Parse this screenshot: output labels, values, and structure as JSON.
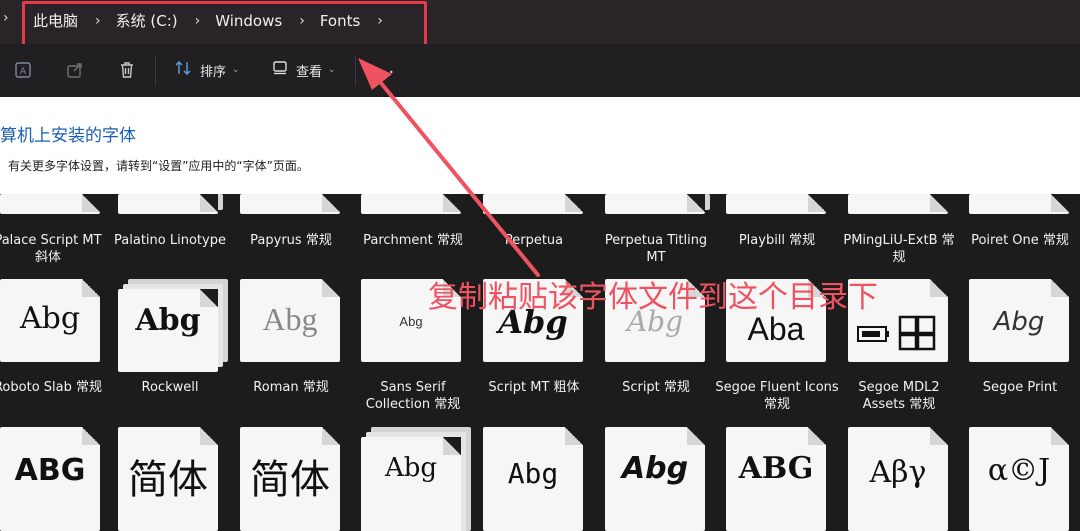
{
  "address": {
    "crumbs": [
      "此电脑",
      "系统 (C:)",
      "Windows",
      "Fonts"
    ]
  },
  "toolbar": {
    "sort_label": "排序",
    "view_label": "查看",
    "more_label": "···",
    "icons": [
      "ai-icon",
      "share-icon",
      "trash-icon",
      "sort-icon",
      "view-icon"
    ]
  },
  "header": {
    "title": "算机上安装的字体",
    "subtitle": "有关更多字体设置，请转到“设置”应用中的“字体”页面。"
  },
  "annotation": "复制粘贴该字体文件到这个目录下",
  "fonts_row1": [
    "Palace Script MT 斜体",
    "Palatino Linotype",
    "Papyrus 常规",
    "Parchment 常规",
    "Perpetua",
    "Perpetua Titling MT",
    "Playbill 常规",
    "PMingLiU-ExtB 常规",
    "Poiret One 常规"
  ],
  "fonts_row2": [
    "Roboto Slab 常规",
    "Rockwell",
    "Roman 常规",
    "Sans Serif Collection 常规",
    "Script MT 粗体",
    "Script 常规",
    "Segoe Fluent Icons 常规",
    "Segoe MDL2 Assets 常规",
    "Segoe Print"
  ],
  "samples_row2": [
    "Abg",
    "Abg",
    "Abg",
    "Abg",
    "Abg",
    "Abg",
    "Aba",
    "",
    "Abg"
  ],
  "samples_row3": [
    "ABG",
    "简体",
    "简体",
    "Abg",
    "Abg",
    "Abg",
    "ABG",
    "Aβγ",
    "α©J"
  ],
  "colors": {
    "accent": "#1a5fb4",
    "annotation": "#ef5361",
    "highlight": "#e23b4a"
  }
}
